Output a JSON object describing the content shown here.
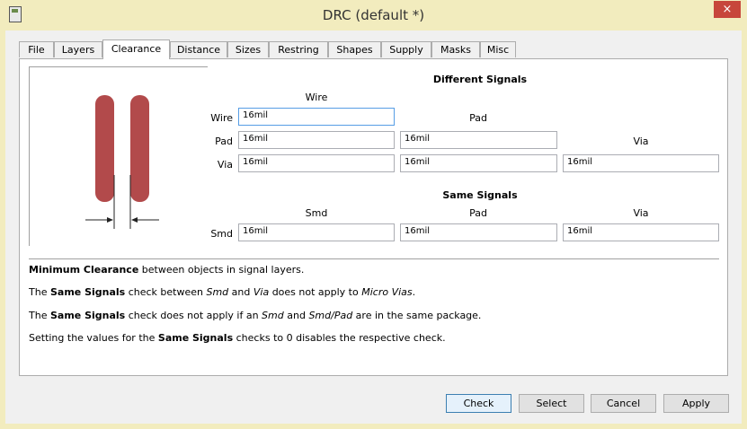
{
  "window": {
    "title": "DRC (default *)",
    "close_glyph": "×"
  },
  "tabs": [
    "File",
    "Layers",
    "Clearance",
    "Distance",
    "Sizes",
    "Restring",
    "Shapes",
    "Supply",
    "Masks",
    "Misc"
  ],
  "active_tab": "Clearance",
  "clearance": {
    "different_signals_title": "Different Signals",
    "col_wire": "Wire",
    "col_pad": "Pad",
    "col_via": "Via",
    "row_wire": "Wire",
    "row_pad": "Pad",
    "row_via": "Via",
    "values": {
      "wire_wire": "16mil",
      "pad_wire": "16mil",
      "pad_pad": "16mil",
      "via_wire": "16mil",
      "via_pad": "16mil",
      "via_via": "16mil"
    },
    "same_signals_title": "Same Signals",
    "same_col_smd": "Smd",
    "same_col_pad": "Pad",
    "same_col_via": "Via",
    "same_row_smd": "Smd",
    "same_values": {
      "smd_smd": "16mil",
      "smd_pad": "16mil",
      "smd_via": "16mil"
    }
  },
  "notes": {
    "n1_b1": "Minimum Clearance",
    "n1_t1": " between objects in signal layers.",
    "n2_t1": "The ",
    "n2_b1": "Same Signals",
    "n2_t2": " check between ",
    "n2_i1": "Smd",
    "n2_t3": " and ",
    "n2_i2": "Via",
    "n2_t4": " does not apply to ",
    "n2_i3": "Micro Vias",
    "n2_t5": ".",
    "n3_t1": "The ",
    "n3_b1": "Same Signals",
    "n3_t2": " check does not apply if an ",
    "n3_i1": "Smd",
    "n3_t3": " and ",
    "n3_i2": "Smd/Pad",
    "n3_t4": " are in the same package.",
    "n4_t1": "Setting the values for the ",
    "n4_b1": "Same Signals",
    "n4_t2": " checks to 0 disables the respective check."
  },
  "buttons": {
    "check": "Check",
    "select": "Select",
    "cancel": "Cancel",
    "apply": "Apply"
  },
  "colors": {
    "title_bg": "#f2ecbe",
    "close_bg": "#c7463b",
    "trace": "#b24a4b"
  }
}
